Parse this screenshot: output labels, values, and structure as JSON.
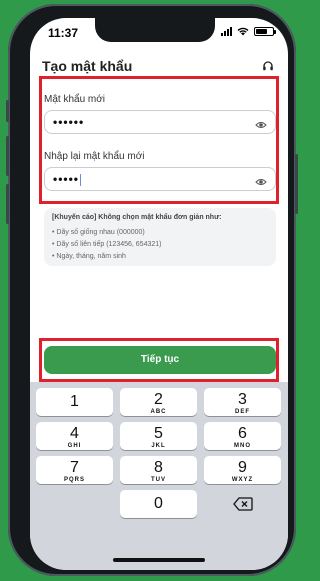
{
  "status_bar": {
    "time": "11:37"
  },
  "header": {
    "title": "Tạo mật khẩu",
    "support_icon": "headset-icon"
  },
  "form": {
    "new_password": {
      "label": "Mật khẩu mới",
      "masked_value": "••••••"
    },
    "confirm_password": {
      "label": "Nhập lại mật khẩu mới",
      "masked_value": "•••••"
    }
  },
  "advice": {
    "heading": "[Khuyến cáo] Không chọn mật khẩu đơn giản như:",
    "items": [
      "• Dãy số giống nhau (000000)",
      "• Dãy số liên tiếp (123456, 654321)",
      "• Ngày, tháng, năm sinh"
    ]
  },
  "continue_button": {
    "label": "Tiếp tục"
  },
  "keypad": {
    "keys": [
      {
        "number": "1",
        "letters": ""
      },
      {
        "number": "2",
        "letters": "ABC"
      },
      {
        "number": "3",
        "letters": "DEF"
      },
      {
        "number": "4",
        "letters": "GHI"
      },
      {
        "number": "5",
        "letters": "JKL"
      },
      {
        "number": "6",
        "letters": "MNO"
      },
      {
        "number": "7",
        "letters": "PQRS"
      },
      {
        "number": "8",
        "letters": "TUV"
      },
      {
        "number": "9",
        "letters": "WXYZ"
      },
      {
        "number": "0",
        "letters": ""
      }
    ],
    "delete_icon": "backspace-icon"
  },
  "colors": {
    "background": "#2f9a4a",
    "highlight": "#e0202a",
    "button": "#3a9b4e"
  }
}
